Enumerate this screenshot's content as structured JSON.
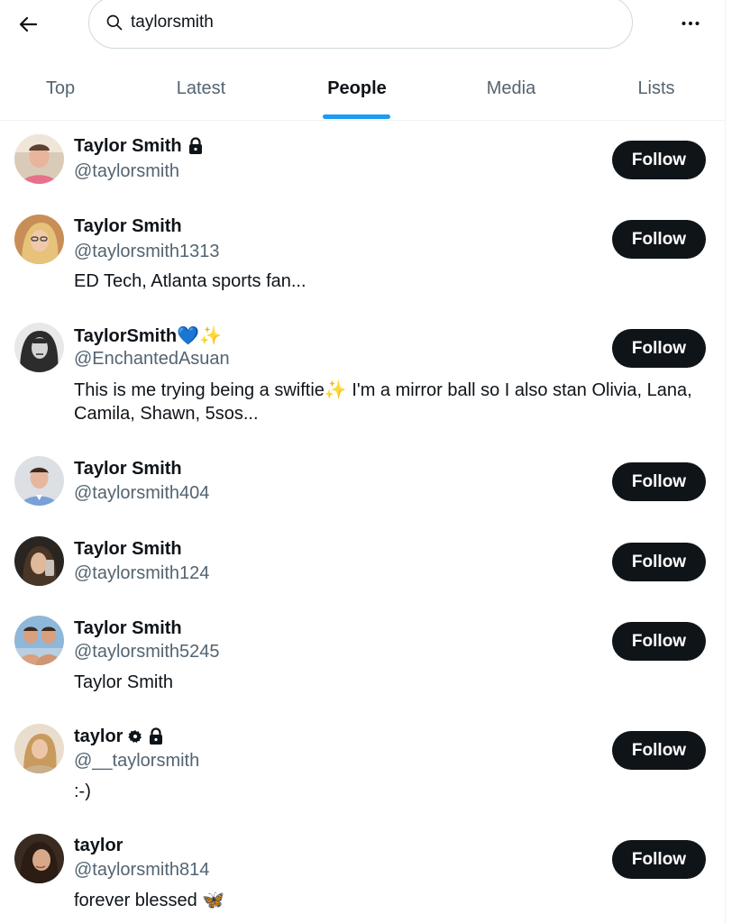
{
  "search": {
    "value": "taylorsmith"
  },
  "tabs": [
    {
      "label": "Top"
    },
    {
      "label": "Latest"
    },
    {
      "label": "People"
    },
    {
      "label": "Media"
    },
    {
      "label": "Lists"
    }
  ],
  "active_tab": "People",
  "colors": {
    "accent": "#1d9bf0",
    "button": "#0f1419",
    "secondary_text": "#536471"
  },
  "users": [
    {
      "name": "Taylor Smith",
      "handle": "@taylorsmith",
      "bio": "",
      "badges": [
        "lock-icon"
      ],
      "follow_label": "Follow"
    },
    {
      "name": "Taylor Smith",
      "handle": "@taylorsmith1313",
      "bio": "ED Tech, Atlanta sports fan...",
      "badges": [],
      "follow_label": "Follow"
    },
    {
      "name": "TaylorSmith💙✨",
      "handle": "@EnchantedAsuan",
      "bio": "This is me trying being a swiftie✨ I'm a mirror ball so I also stan Olivia, Lana, Camila, Shawn, 5sos...",
      "badges": [],
      "follow_label": "Follow"
    },
    {
      "name": "Taylor Smith",
      "handle": "@taylorsmith404",
      "bio": "",
      "badges": [],
      "follow_label": "Follow"
    },
    {
      "name": "Taylor Smith",
      "handle": "@taylorsmith124",
      "bio": "",
      "badges": [],
      "follow_label": "Follow"
    },
    {
      "name": "Taylor Smith",
      "handle": "@taylorsmith5245",
      "bio": "Taylor Smith",
      "badges": [],
      "follow_label": "Follow"
    },
    {
      "name": "taylor",
      "handle": "@__taylorsmith",
      "bio": ":-)",
      "badges": [
        "gear-badge-icon",
        "lock-icon"
      ],
      "follow_label": "Follow"
    },
    {
      "name": "taylor",
      "handle": "@taylorsmith814",
      "bio": "forever blessed 🦋",
      "badges": [],
      "follow_label": "Follow"
    }
  ]
}
